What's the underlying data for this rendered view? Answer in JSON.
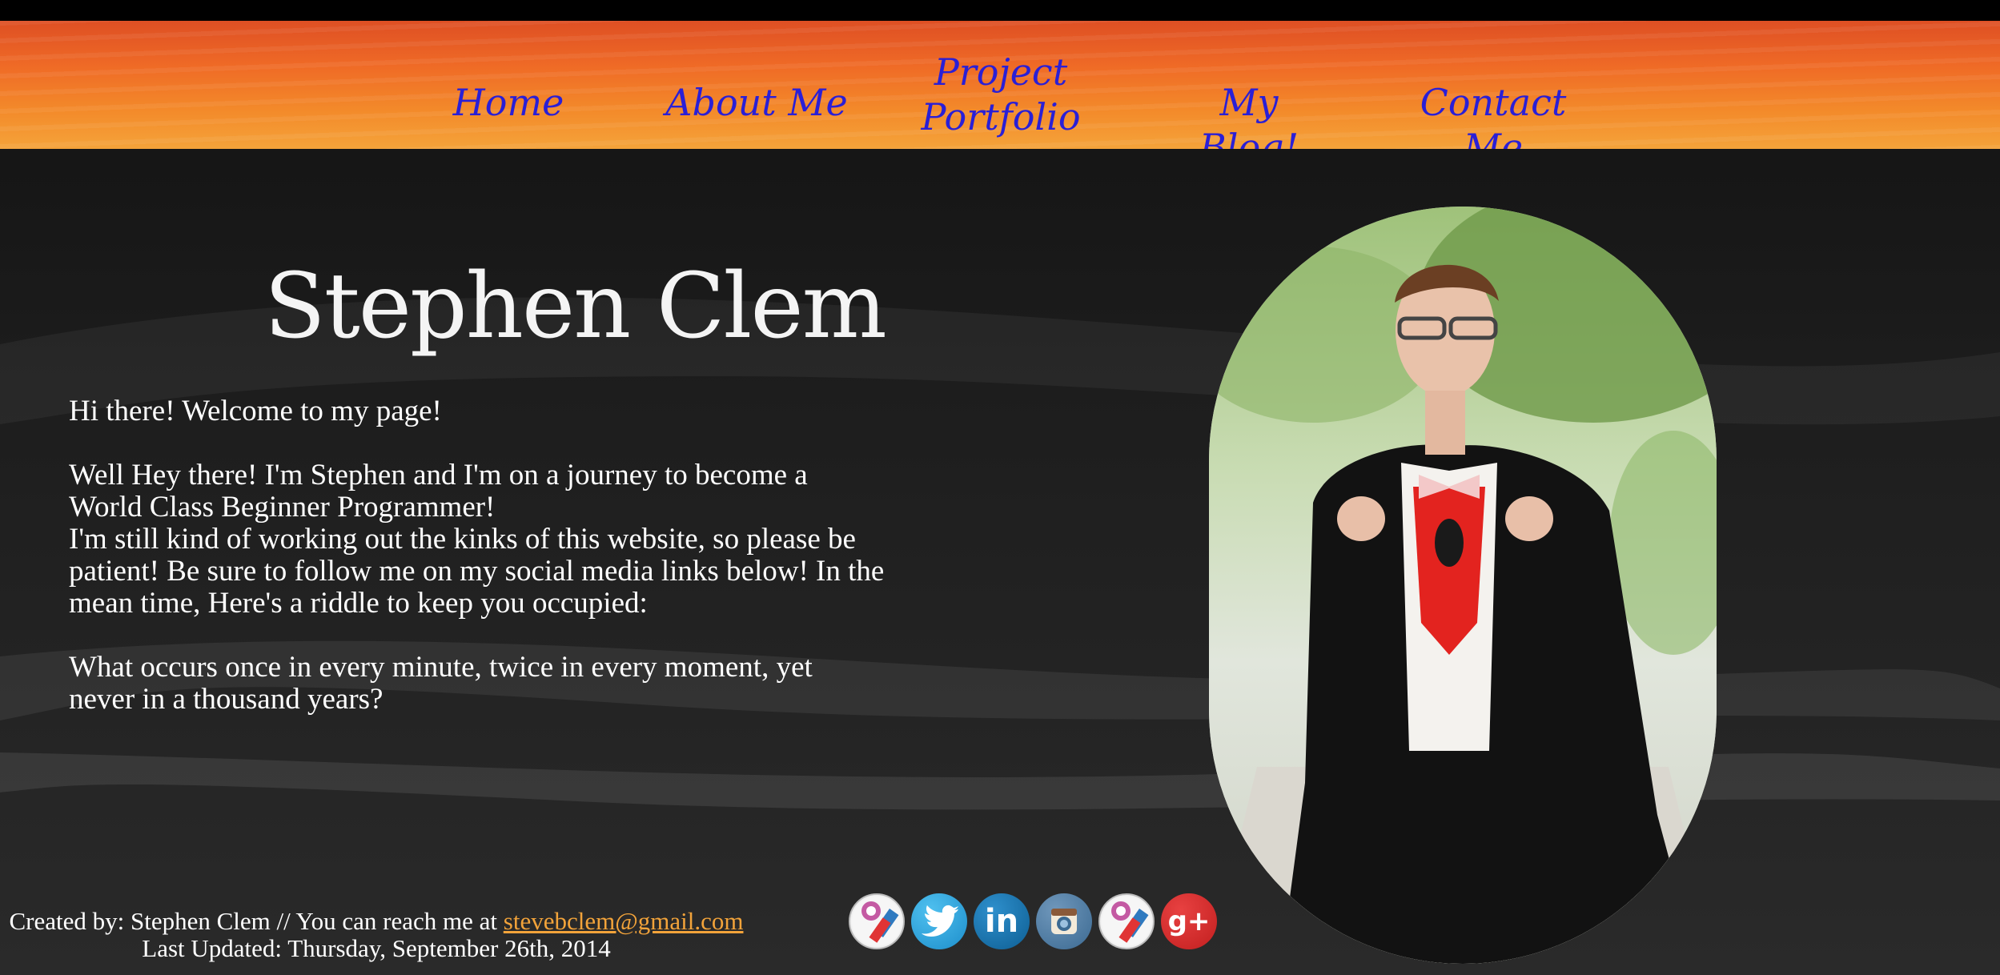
{
  "nav": {
    "items": [
      {
        "label": "Home"
      },
      {
        "label": "About Me"
      },
      {
        "label": "Project Portfolio"
      },
      {
        "label": "My Blog!"
      },
      {
        "label": "Contact Me"
      }
    ]
  },
  "hero": {
    "title": "Stephen Clem",
    "greeting": "Hi there! Welcome to my page!",
    "paragraph1": "Well Hey there! I'm Stephen and I'm on a journey to become a World Class Beginner Programmer!",
    "paragraph2": "I'm still kind of working out the kinks of this website, so please be patient! Be sure to follow me on my social media links below! In the mean time, Here's a riddle to keep you occupied:",
    "riddle": "What occurs once in every minute, twice in every moment, yet never in a thousand years?"
  },
  "footer": {
    "created_prefix": "Created by: Stephen Clem // You can reach me at",
    "email": "stevebclem@gmail.com",
    "last_updated": "Last Updated: Thursday, September 26th, 2014"
  },
  "social": {
    "icons": [
      {
        "name": "offiicons-icon"
      },
      {
        "name": "twitter-icon"
      },
      {
        "name": "linkedin-icon"
      },
      {
        "name": "instagram-icon"
      },
      {
        "name": "offiicons-icon"
      },
      {
        "name": "google-plus-icon"
      }
    ]
  },
  "colors": {
    "nav_link": "#2a1fd6",
    "email_link": "#f2a33a",
    "header_orange": "#ef6a26"
  }
}
